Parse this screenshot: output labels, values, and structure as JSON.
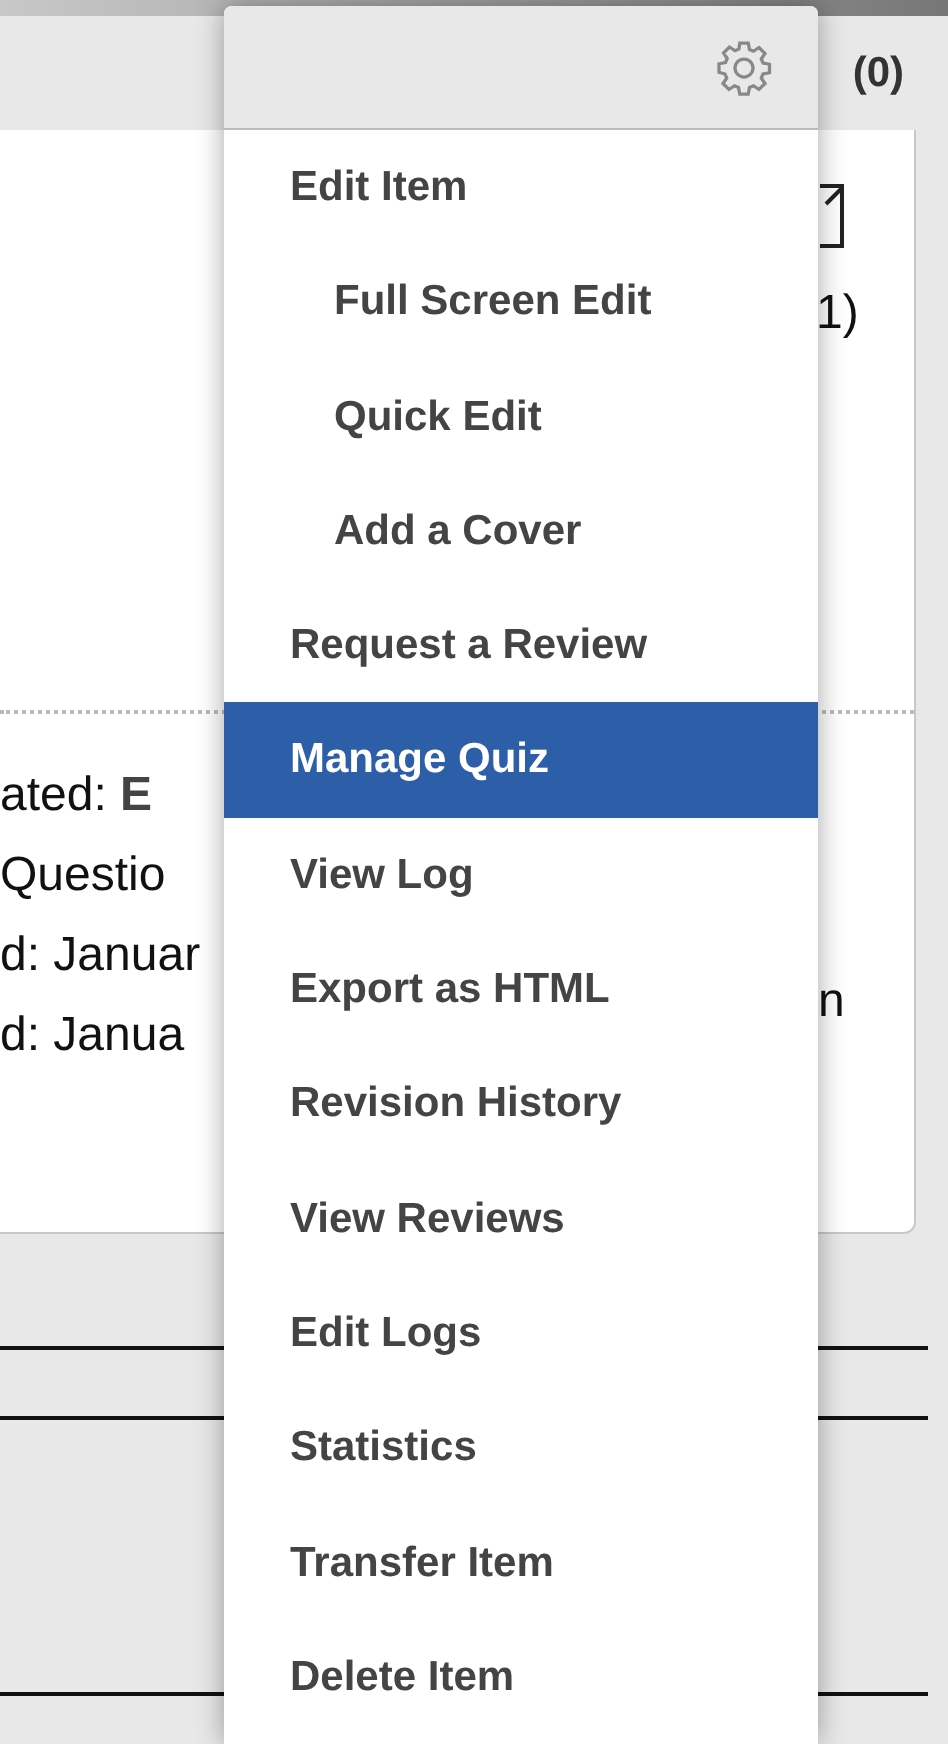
{
  "header": {
    "count": "(0)"
  },
  "card": {
    "top_right_text": "1)",
    "left_lines": [
      "ated: **E**",
      "Questio",
      "d: Januar",
      "d: Janua"
    ],
    "right_fragment": "n"
  },
  "menu": {
    "items": [
      {
        "label": "Edit Item",
        "selected": false,
        "children": [
          {
            "label": "Full Screen Edit",
            "selected": false
          },
          {
            "label": "Quick Edit",
            "selected": false
          },
          {
            "label": "Add a Cover",
            "selected": false
          }
        ]
      },
      {
        "label": "Request a Review",
        "selected": false
      },
      {
        "label": "Manage Quiz",
        "selected": true
      },
      {
        "label": "View Log",
        "selected": false
      },
      {
        "label": "Export as HTML",
        "selected": false
      },
      {
        "label": "Revision History",
        "selected": false
      },
      {
        "label": "View Reviews",
        "selected": false
      },
      {
        "label": "Edit Logs",
        "selected": false
      },
      {
        "label": "Statistics",
        "selected": false
      },
      {
        "label": "Transfer Item",
        "selected": false
      },
      {
        "label": "Delete Item",
        "selected": false
      }
    ]
  }
}
